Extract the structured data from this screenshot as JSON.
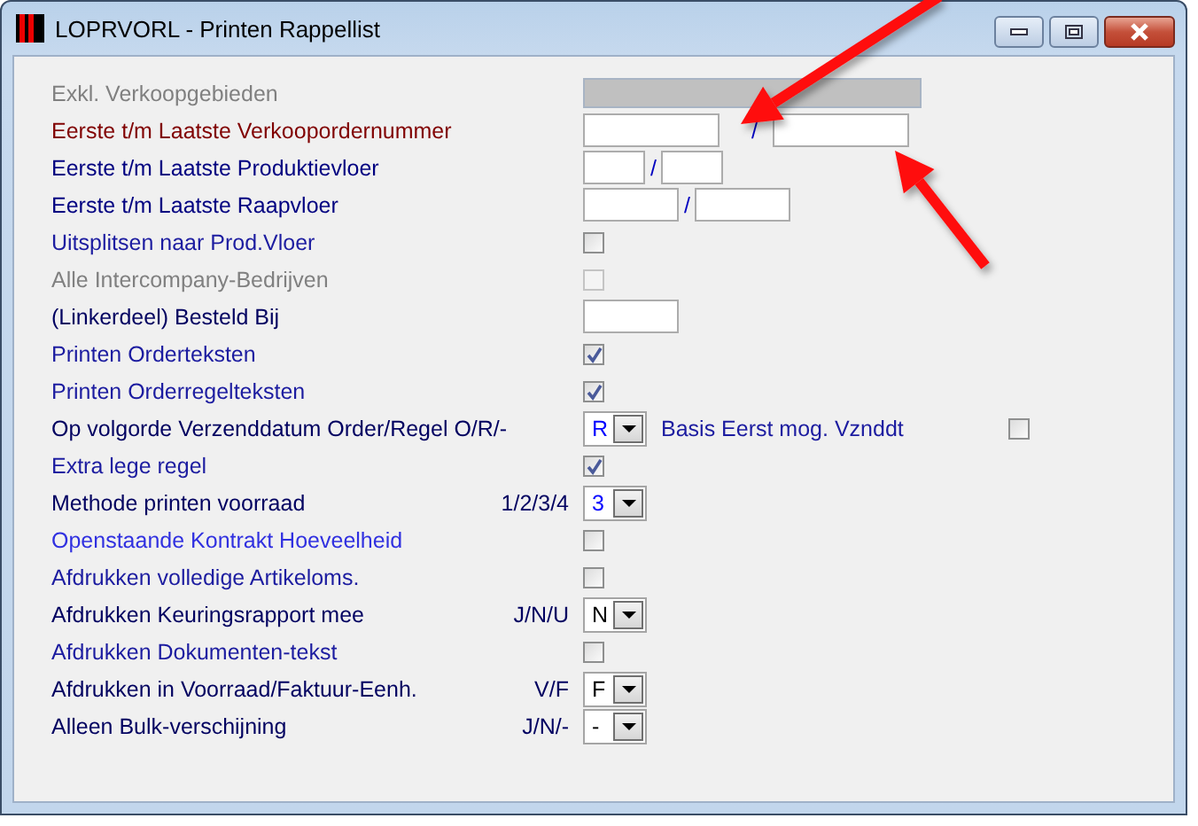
{
  "window": {
    "title": "LOPRVORL - Printen Rappellist"
  },
  "rows": [
    {
      "label": "Exkl. Verkoopgebieden",
      "color": "#808080",
      "kind": "display"
    },
    {
      "label": "Eerste t/m Laatste Verkoopordernummer",
      "color": "#800000",
      "kind": "range",
      "separator": "/"
    },
    {
      "label": "Eerste t/m Laatste Produktievloer",
      "color": "#000080",
      "kind": "range",
      "separator": "/"
    },
    {
      "label": "Eerste t/m Laatste Raapvloer",
      "color": "#000080",
      "kind": "range",
      "separator": "/"
    },
    {
      "label": "Uitsplitsen naar Prod.Vloer",
      "color": "#1c1ca0",
      "kind": "checkbox",
      "checked": false,
      "disabled": false
    },
    {
      "label": "Alle Intercompany-Bedrijven",
      "color": "#808080",
      "kind": "checkbox",
      "checked": false,
      "disabled": true
    },
    {
      "label": "(Linkerdeel) Besteld Bij",
      "color": "#000060",
      "kind": "field"
    },
    {
      "label": "Printen Orderteksten",
      "color": "#1c1ca0",
      "kind": "checkbox",
      "checked": true,
      "disabled": false
    },
    {
      "label": "Printen Orderregelteksten",
      "color": "#1c1ca0",
      "kind": "checkbox",
      "checked": true,
      "disabled": false
    },
    {
      "label": "Op volgorde Verzenddatum Order/Regel O/R/-",
      "color": "#000060",
      "kind": "dropdown",
      "dropdown": {
        "value": "R",
        "color": "#0000ff"
      },
      "extra": {
        "label": "Basis Eerst mog. Vznddt",
        "checked": false
      }
    },
    {
      "label": "Extra lege regel",
      "color": "#1c1ca0",
      "kind": "checkbox",
      "checked": true,
      "disabled": false
    },
    {
      "label": "Methode printen voorraad",
      "hint": "1/2/3/4",
      "color": "#000060",
      "kind": "dropdown",
      "dropdown": {
        "value": "3",
        "color": "#0000ff"
      }
    },
    {
      "label": "Openstaande Kontrakt Hoeveelheid",
      "color": "#3030e0",
      "kind": "checkbox",
      "checked": false,
      "disabled": false
    },
    {
      "label": "Afdrukken volledige Artikeloms.",
      "color": "#1c1ca0",
      "kind": "checkbox",
      "checked": false,
      "disabled": false
    },
    {
      "label": "Afdrukken Keuringsrapport mee",
      "hint": "J/N/U",
      "color": "#000060",
      "kind": "dropdown",
      "dropdown": {
        "value": "N",
        "color": "#000000"
      }
    },
    {
      "label": "Afdrukken Dokumenten-tekst",
      "color": "#1c1ca0",
      "kind": "checkbox",
      "checked": false,
      "disabled": false
    },
    {
      "label": "Afdrukken in Voorraad/Faktuur-Eenh.",
      "hint": "V/F",
      "color": "#000060",
      "kind": "dropdown",
      "dropdown": {
        "value": "F",
        "color": "#000000"
      }
    },
    {
      "label": "Alleen Bulk-verschijning",
      "hint": "J/N/-",
      "color": "#000060",
      "kind": "dropdown",
      "dropdown": {
        "value": "-",
        "color": "#000000"
      }
    }
  ]
}
